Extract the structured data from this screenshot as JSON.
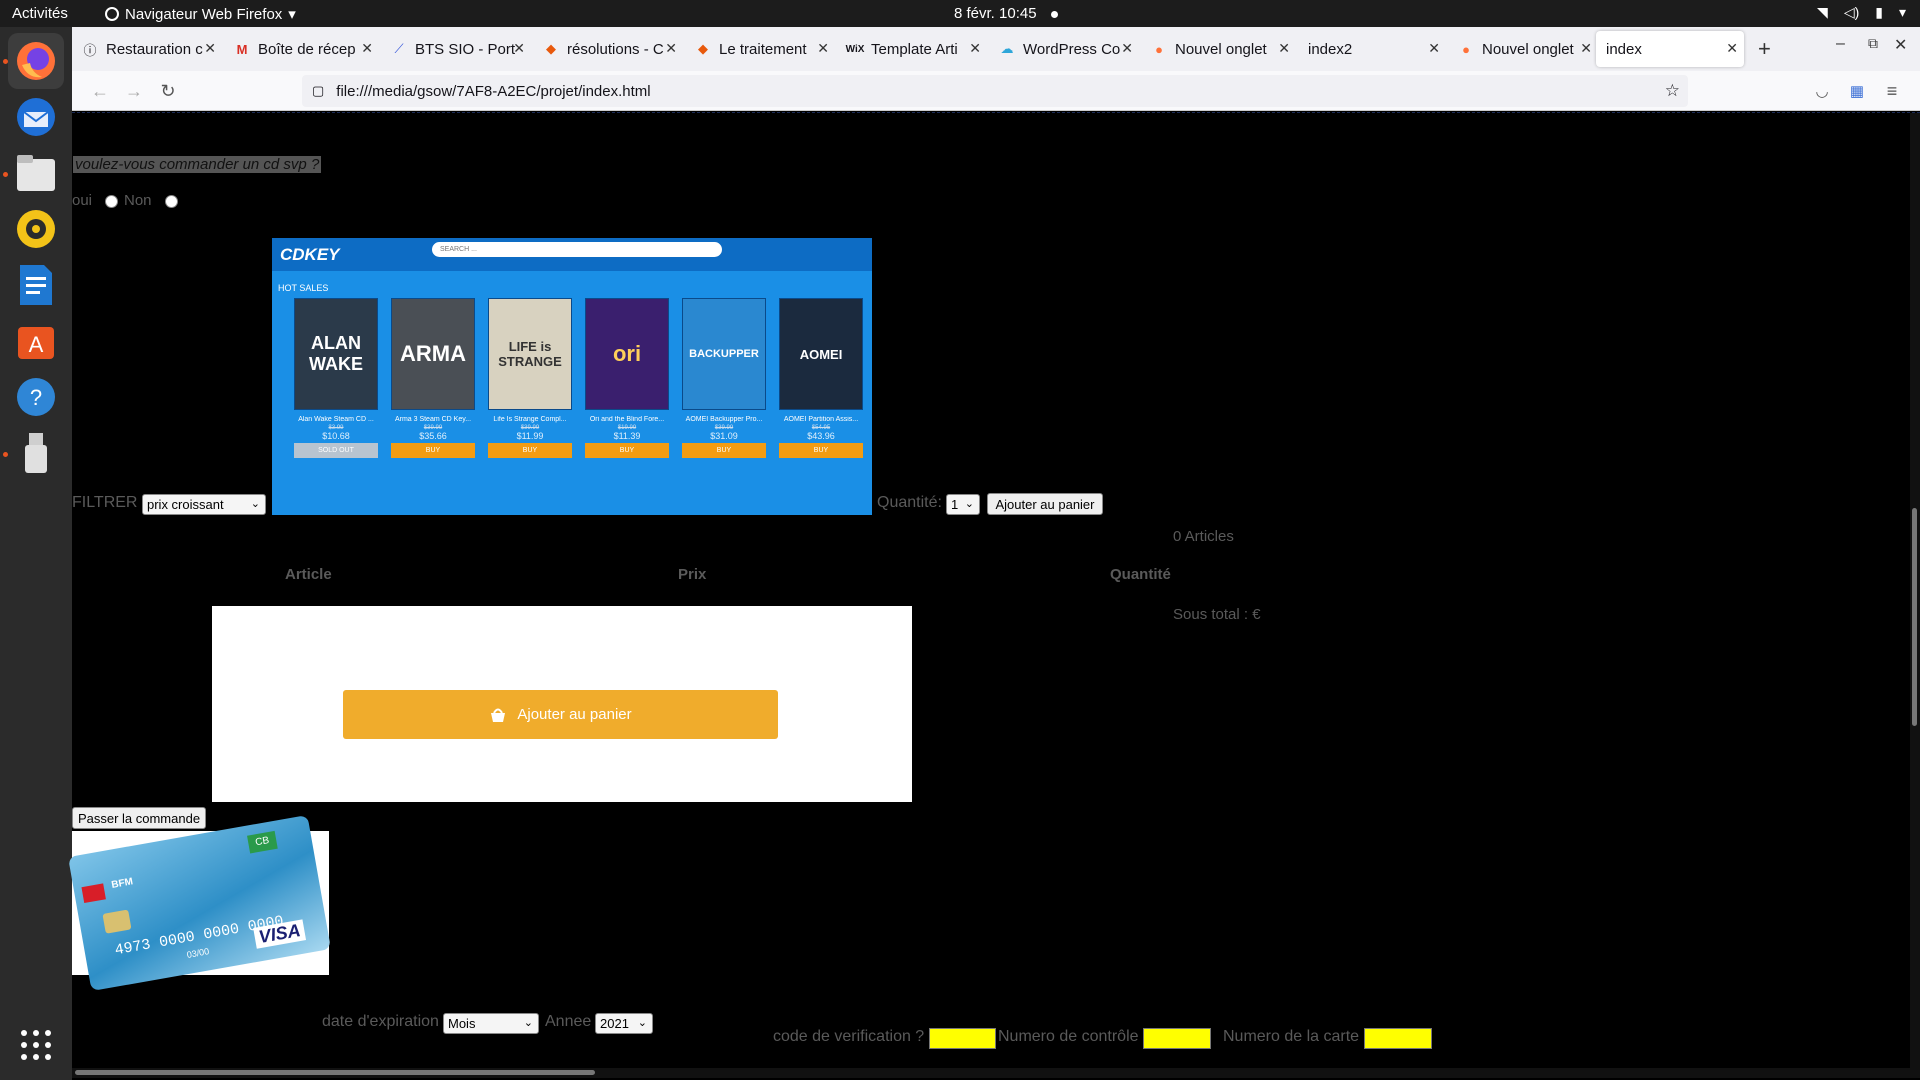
{
  "system": {
    "activities": "Activités",
    "app_menu": "Navigateur Web Firefox",
    "clock": "8 févr.  10:45"
  },
  "dock": [
    "firefox-icon",
    "thunderbird-icon",
    "files-icon",
    "rhythmbox-icon",
    "writer-icon",
    "software-icon",
    "help-icon",
    "usb-drive-icon",
    "app-grid-icon"
  ],
  "browser": {
    "tabs": [
      {
        "label": "Restauration c"
      },
      {
        "label": "Boîte de récep"
      },
      {
        "label": "BTS SIO - Port"
      },
      {
        "label": "résolutions - C"
      },
      {
        "label": "Le traitement"
      },
      {
        "label": "Template Arti"
      },
      {
        "label": "WordPress Co"
      },
      {
        "label": "Nouvel onglet"
      },
      {
        "label": "index2"
      },
      {
        "label": "Nouvel onglet"
      },
      {
        "label": "index"
      }
    ],
    "url": "file:///media/gsow/7AF8-A2EC/projet/index.html"
  },
  "page": {
    "question": "voulez-vous commander un cd svp ?",
    "oui_label": "oui",
    "non_label": "Non",
    "filter_label": "FILTRER",
    "filter_value": "prix croissant",
    "quantity_label": "Quantité:",
    "quantity_value": "1",
    "add_cart_button": "Ajouter au panier",
    "articles_count": "0 Articles",
    "col_article": "Article",
    "col_prix": "Prix",
    "col_quantite": "Quantité",
    "subtotal": "Sous total : €",
    "order_button": "Passer la commande",
    "expiry_label": "date d'expiration",
    "month_value": "Mois",
    "year_label": "Annee",
    "year_value": "2021",
    "verif_label": "code de verification ?",
    "control_label": "Numero de contrôle",
    "card_number_label": "Numero de la carte"
  },
  "cdkey": {
    "logo": "CDKEY",
    "search_placeholder": "SEARCH ...",
    "hot_sales": "HOT SALES",
    "games": [
      {
        "cover": "ALAN WAKE",
        "name": "Alan Wake Steam CD ...",
        "old": "$3.99",
        "price": "$10.68",
        "buy": "SOLD OUT"
      },
      {
        "cover": "ARMA",
        "name": "Arma 3 Steam CD Key...",
        "old": "$39.99",
        "price": "$35.66",
        "buy": "BUY"
      },
      {
        "cover": "LIFE is STRANGE",
        "name": "Life Is Strange Compl...",
        "old": "$39.99",
        "price": "$11.99",
        "buy": "BUY"
      },
      {
        "cover": "ori",
        "name": "Ori and the Blind Fore...",
        "old": "$19.99",
        "price": "$11.39",
        "buy": "BUY"
      },
      {
        "cover": "BACKUPPER",
        "name": "AOMEI Backupper Pro...",
        "old": "$39.99",
        "price": "$31.09",
        "buy": "BUY"
      },
      {
        "cover": "AOMEI",
        "name": "AOMEI Partition Assis...",
        "old": "$54.95",
        "price": "$43.96",
        "buy": "BUY"
      }
    ]
  },
  "cart_image": {
    "button": "Ajouter au panier"
  },
  "card_image": {
    "number": "4973 0000 0000 0000",
    "brand": "VISA",
    "bank": "BFM",
    "expiry": "03/00"
  }
}
